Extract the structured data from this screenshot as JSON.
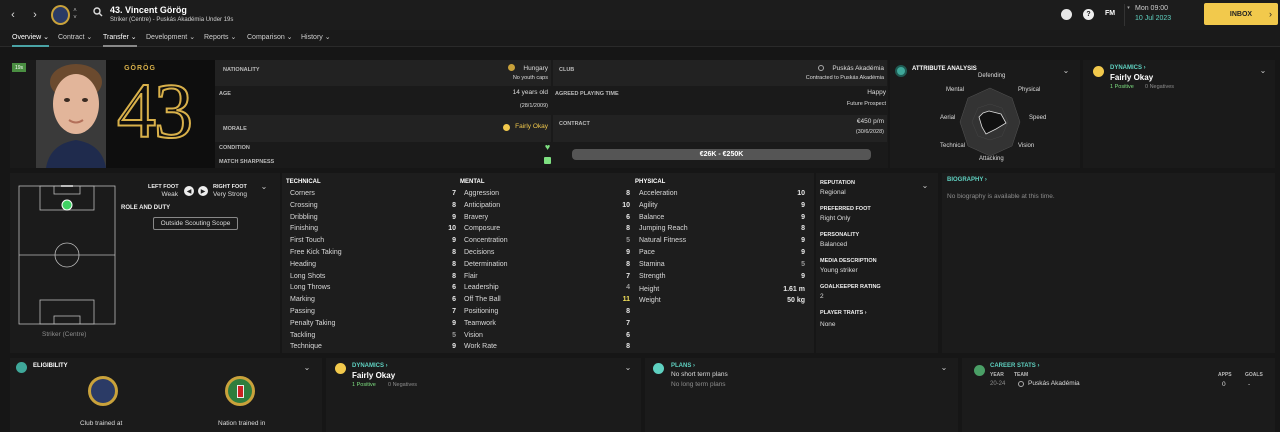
{
  "header": {
    "player_title": "43. Vincent Görög",
    "subtitle": "Striker (Centre) - Puskás Akadémia Under 19s",
    "date_line1": "Mon 09:00",
    "date_line2": "10 Jul 2023",
    "inbox_label": "INBOX",
    "fm_label": "FM",
    "help_label": "?"
  },
  "tabs": [
    {
      "label": "Overview ⌄"
    },
    {
      "label": "Contract ⌄"
    },
    {
      "label": "Transfer ⌄"
    },
    {
      "label": "Development ⌄"
    },
    {
      "label": "Reports ⌄"
    },
    {
      "label": "Comparison ⌄"
    },
    {
      "label": "History ⌄"
    }
  ],
  "profile": {
    "age_badge": "19s",
    "shirt_name": "GÖRÖG",
    "shirt_number": "43",
    "nationality_label": "NATIONALITY",
    "nationality": "Hungary",
    "youth_caps": "No youth caps",
    "club_label": "CLUB",
    "club": "Puskás Akadémia",
    "contracted": "Contracted to Puskás Akadémia",
    "age_label": "AGE",
    "age": "14 years old",
    "dob": "(28/1/2009)",
    "agreed_label": "AGREED PLAYING TIME",
    "agreed": "Happy",
    "future": "Future Prospect",
    "morale_label": "MORALE",
    "morale": "Fairly Okay",
    "contract_label": "CONTRACT",
    "wage": "€450 p/m",
    "expiry": "(30/6/2028)",
    "condition_label": "CONDITION",
    "sharpness_label": "MATCH SHARPNESS",
    "value_range": "€26K - €250K",
    "condition_level": 0.95,
    "sharpness_level": 0.9
  },
  "attribute_analysis": {
    "title": "ATTRIBUTE ANALYSIS",
    "labels": [
      "Defending",
      "Physical",
      "Speed",
      "Vision",
      "Attacking",
      "Technical",
      "Aerial",
      "Mental"
    ]
  },
  "dynamics_top": {
    "title": "DYNAMICS ›",
    "status": "Fairly Okay",
    "positive": "1 Positive",
    "negative": "0 Negatives"
  },
  "position": {
    "left_foot_label": "LEFT FOOT",
    "left_foot": "Weak",
    "right_foot_label": "RIGHT FOOT",
    "right_foot": "Very Strong",
    "role_label": "ROLE AND DUTY",
    "scope_button": "Outside Scouting Scope",
    "position_name": "Striker (Centre)"
  },
  "technical": {
    "title": "TECHNICAL",
    "items": [
      {
        "name": "Corners",
        "value": "7"
      },
      {
        "name": "Crossing",
        "value": "8"
      },
      {
        "name": "Dribbling",
        "value": "9"
      },
      {
        "name": "Finishing",
        "value": "10"
      },
      {
        "name": "First Touch",
        "value": "9"
      },
      {
        "name": "Free Kick Taking",
        "value": "8"
      },
      {
        "name": "Heading",
        "value": "8"
      },
      {
        "name": "Long Shots",
        "value": "8"
      },
      {
        "name": "Long Throws",
        "value": "6"
      },
      {
        "name": "Marking",
        "value": "6"
      },
      {
        "name": "Passing",
        "value": "7"
      },
      {
        "name": "Penalty Taking",
        "value": "9"
      },
      {
        "name": "Tackling",
        "value": "5"
      },
      {
        "name": "Technique",
        "value": "9"
      }
    ]
  },
  "mental": {
    "title": "MENTAL",
    "items": [
      {
        "name": "Aggression",
        "value": "8"
      },
      {
        "name": "Anticipation",
        "value": "10"
      },
      {
        "name": "Bravery",
        "value": "6"
      },
      {
        "name": "Composure",
        "value": "8"
      },
      {
        "name": "Concentration",
        "value": "5"
      },
      {
        "name": "Decisions",
        "value": "9"
      },
      {
        "name": "Determination",
        "value": "8"
      },
      {
        "name": "Flair",
        "value": "7"
      },
      {
        "name": "Leadership",
        "value": "4"
      },
      {
        "name": "Off The Ball",
        "value": "11"
      },
      {
        "name": "Positioning",
        "value": "8"
      },
      {
        "name": "Teamwork",
        "value": "7"
      },
      {
        "name": "Vision",
        "value": "6"
      },
      {
        "name": "Work Rate",
        "value": "8"
      }
    ]
  },
  "physical": {
    "title": "PHYSICAL",
    "items": [
      {
        "name": "Acceleration",
        "value": "10"
      },
      {
        "name": "Agility",
        "value": "9"
      },
      {
        "name": "Balance",
        "value": "9"
      },
      {
        "name": "Jumping Reach",
        "value": "8"
      },
      {
        "name": "Natural Fitness",
        "value": "9"
      },
      {
        "name": "Pace",
        "value": "9"
      },
      {
        "name": "Stamina",
        "value": "5"
      },
      {
        "name": "Strength",
        "value": "9"
      }
    ],
    "height_label": "Height",
    "height": "1.61 m",
    "weight_label": "Weight",
    "weight": "50 kg"
  },
  "info": {
    "reputation_label": "REPUTATION",
    "reputation": "Regional",
    "foot_label": "PREFERRED FOOT",
    "foot": "Right Only",
    "personality_label": "PERSONALITY",
    "personality": "Balanced",
    "media_label": "MEDIA DESCRIPTION",
    "media": "Young striker",
    "gk_label": "GOALKEEPER RATING",
    "gk": "2",
    "traits_label": "PLAYER TRAITS ›",
    "traits": "None"
  },
  "biography": {
    "title": "BIOGRAPHY ›",
    "text": "No biography is available at this time."
  },
  "eligibility": {
    "title": "ELIGIBILITY",
    "club_trained": "Club trained at",
    "nation_trained": "Nation trained in"
  },
  "dynamics_bottom": {
    "title": "DYNAMICS ›",
    "status": "Fairly Okay",
    "positive": "1 Positive",
    "negative": "0 Negatives"
  },
  "plans": {
    "title": "PLANS ›",
    "short": "No short term plans",
    "long": "No long term plans"
  },
  "career": {
    "title": "CAREER STATS ›",
    "year_label": "YEAR",
    "team_label": "TEAM",
    "apps_label": "APPS",
    "goals_label": "GOALS",
    "year": "20-24",
    "team": "Puskás Akadémia",
    "apps": "0",
    "goals": "-"
  },
  "colors": {
    "accent": "#4aa3a5",
    "inbox": "#f2c94c",
    "gold": "#d8b04a",
    "positive": "#7ee081"
  }
}
